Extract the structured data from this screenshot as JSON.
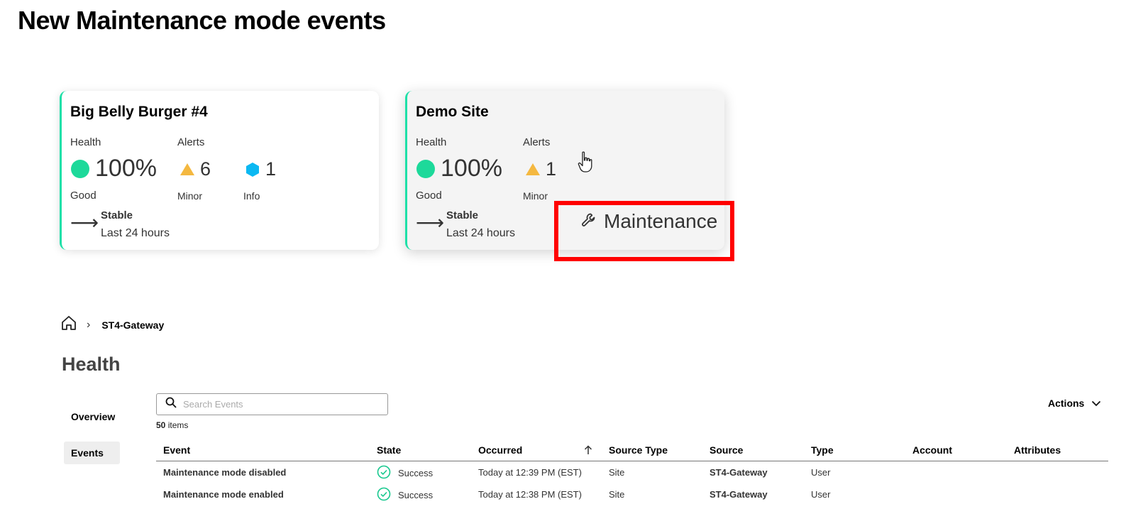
{
  "page": {
    "title": "New Maintenance mode events"
  },
  "cards": [
    {
      "title": "Big Belly Burger #4",
      "health_label": "Health",
      "health_value": "100%",
      "health_status": "Good",
      "alerts_label": "Alerts",
      "minor_count": "6",
      "minor_label": "Minor",
      "info_count": "1",
      "info_label": "Info",
      "trend_title": "Stable",
      "trend_period": "Last 24 hours"
    },
    {
      "title": "Demo Site",
      "health_label": "Health",
      "health_value": "100%",
      "health_status": "Good",
      "alerts_label": "Alerts",
      "minor_count": "1",
      "minor_label": "Minor",
      "trend_title": "Stable",
      "trend_period": "Last 24 hours",
      "maintenance_label": "Maintenance"
    }
  ],
  "colors": {
    "accent_green": "#1ee0a8",
    "good_dot": "#1dd99a",
    "minor_alert": "#f4b840",
    "info_alert": "#0bb8f2",
    "highlight": "#ff0000",
    "success": "#17c88e"
  },
  "breadcrumb": {
    "home_icon": "home-icon",
    "current": "ST4-Gateway"
  },
  "section": {
    "title": "Health"
  },
  "nav": {
    "items": [
      {
        "label": "Overview"
      },
      {
        "label": "Events"
      }
    ]
  },
  "search": {
    "placeholder": "Search Events",
    "value": ""
  },
  "items": {
    "count": "50",
    "suffix": "items"
  },
  "actions": {
    "label": "Actions"
  },
  "table": {
    "headers": [
      "Event",
      "State",
      "Occurred",
      "Source Type",
      "Source",
      "Type",
      "Account",
      "Attributes"
    ],
    "sort_icon": "arrow-up-icon",
    "rows": [
      {
        "event": "Maintenance mode disabled",
        "state": "Success",
        "occurred": "Today at 12:39 PM (EST)",
        "source_type": "Site",
        "source": "ST4-Gateway",
        "type": "User",
        "account": "",
        "attributes": ""
      },
      {
        "event": "Maintenance mode enabled",
        "state": "Success",
        "occurred": "Today at 12:38 PM (EST)",
        "source_type": "Site",
        "source": "ST4-Gateway",
        "type": "User",
        "account": "",
        "attributes": ""
      }
    ]
  }
}
